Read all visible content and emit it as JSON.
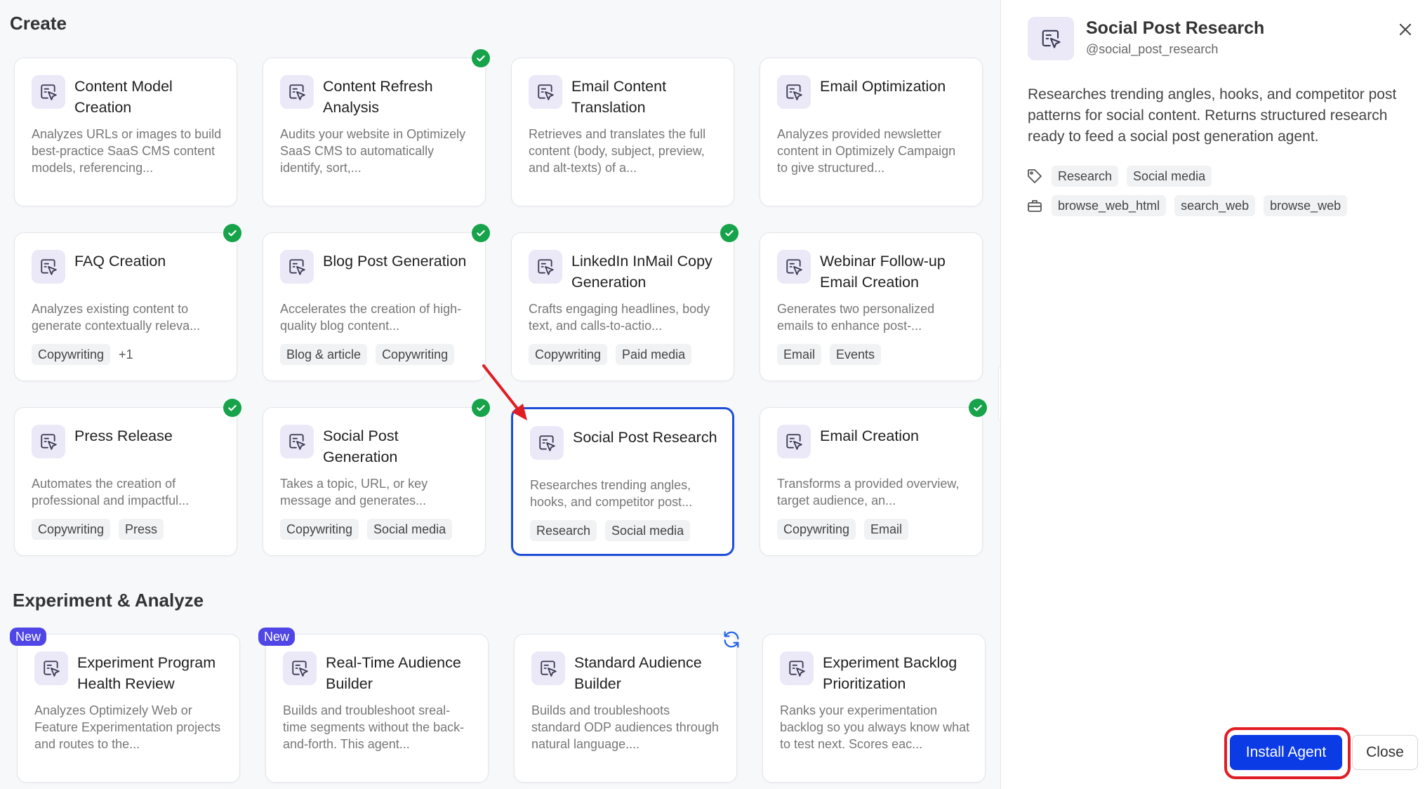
{
  "sections": {
    "create": "Create",
    "experiment": "Experiment & Analyze"
  },
  "cards": [
    {
      "title": "Content Model Creation",
      "desc": "Analyzes URLs or images to build best-practice SaaS CMS content models, referencing...",
      "tags": [],
      "installed": false
    },
    {
      "title": "Content Refresh Analysis",
      "desc": "Audits your website in Optimizely SaaS CMS to automatically identify, sort,...",
      "tags": [],
      "installed": true
    },
    {
      "title": "Email Content Translation",
      "desc": "Retrieves and translates the full content (body, subject, preview, and alt-texts) of a...",
      "tags": [],
      "installed": false
    },
    {
      "title": "Email Optimization",
      "desc": "Analyzes provided newsletter content in Optimizely Campaign to give structured...",
      "tags": [],
      "installed": false
    },
    {
      "title": "FAQ Creation",
      "desc": "Analyzes existing content to generate contextually releva...",
      "tags": [
        "Copywriting"
      ],
      "more": "+1",
      "installed": true
    },
    {
      "title": "Blog Post Generation",
      "desc": "Accelerates the creation of high-quality blog content...",
      "tags": [
        "Blog & article",
        "Copywriting"
      ],
      "installed": true
    },
    {
      "title": "LinkedIn InMail Copy Generation",
      "desc": "Crafts engaging headlines, body text, and calls-to-actio...",
      "tags": [
        "Copywriting",
        "Paid media"
      ],
      "installed": true
    },
    {
      "title": "Webinar Follow-up Email Creation",
      "desc": "Generates two personalized emails to enhance post-...",
      "tags": [
        "Email",
        "Events"
      ],
      "installed": false
    },
    {
      "title": "Press Release",
      "desc": "Automates the creation of professional and impactful...",
      "tags": [
        "Copywriting",
        "Press"
      ],
      "installed": true
    },
    {
      "title": "Social Post Generation",
      "desc": "Takes a topic, URL, or key message and generates...",
      "tags": [
        "Copywriting",
        "Social media"
      ],
      "installed": true
    },
    {
      "title": "Social Post Research",
      "desc": "Researches trending angles, hooks, and competitor post...",
      "tags": [
        "Research",
        "Social media"
      ],
      "installed": false,
      "selected": true
    },
    {
      "title": "Email Creation",
      "desc": "Transforms a provided overview, target audience, an...",
      "tags": [
        "Copywriting",
        "Email"
      ],
      "installed": true
    },
    {
      "title": "Experiment Program Health Review",
      "desc": "Analyzes Optimizely Web or Feature Experimentation projects and routes to the...",
      "tags": [],
      "badge": "New"
    },
    {
      "title": "Real-Time Audience Builder",
      "desc": "Builds and troubleshoot sreal-time segments without the back-and-forth. This agent...",
      "tags": [],
      "badge": "New"
    },
    {
      "title": "Standard Audience Builder",
      "desc": "Builds and troubleshoots standard ODP audiences through natural language....",
      "tags": [],
      "sync": true
    },
    {
      "title": "Experiment Backlog Prioritization",
      "desc": "Ranks your experimentation backlog so you always know what to test next. Scores eac...",
      "tags": []
    }
  ],
  "detail": {
    "title": "Social Post Research",
    "handle": "@social_post_research",
    "description": "Researches trending angles, hooks, and competitor post patterns for social content. Returns structured research ready to feed a social post generation agent.",
    "tags": [
      "Research",
      "Social media"
    ],
    "tools": [
      "browse_web_html",
      "search_web",
      "browse_web"
    ],
    "install_label": "Install Agent",
    "close_label": "Close"
  },
  "colors": {
    "accent": "#0b3be5",
    "installed_check": "#16a34a",
    "new_badge": "#4f46e5",
    "highlight_outline": "#e11d24",
    "icon_bg": "#ebe8f7"
  },
  "icons": {
    "agent": "cursor-select-icon",
    "tag": "tag-icon",
    "tools": "toolbox-icon",
    "close": "close-icon",
    "check": "check-icon",
    "sync": "sync-icon"
  }
}
